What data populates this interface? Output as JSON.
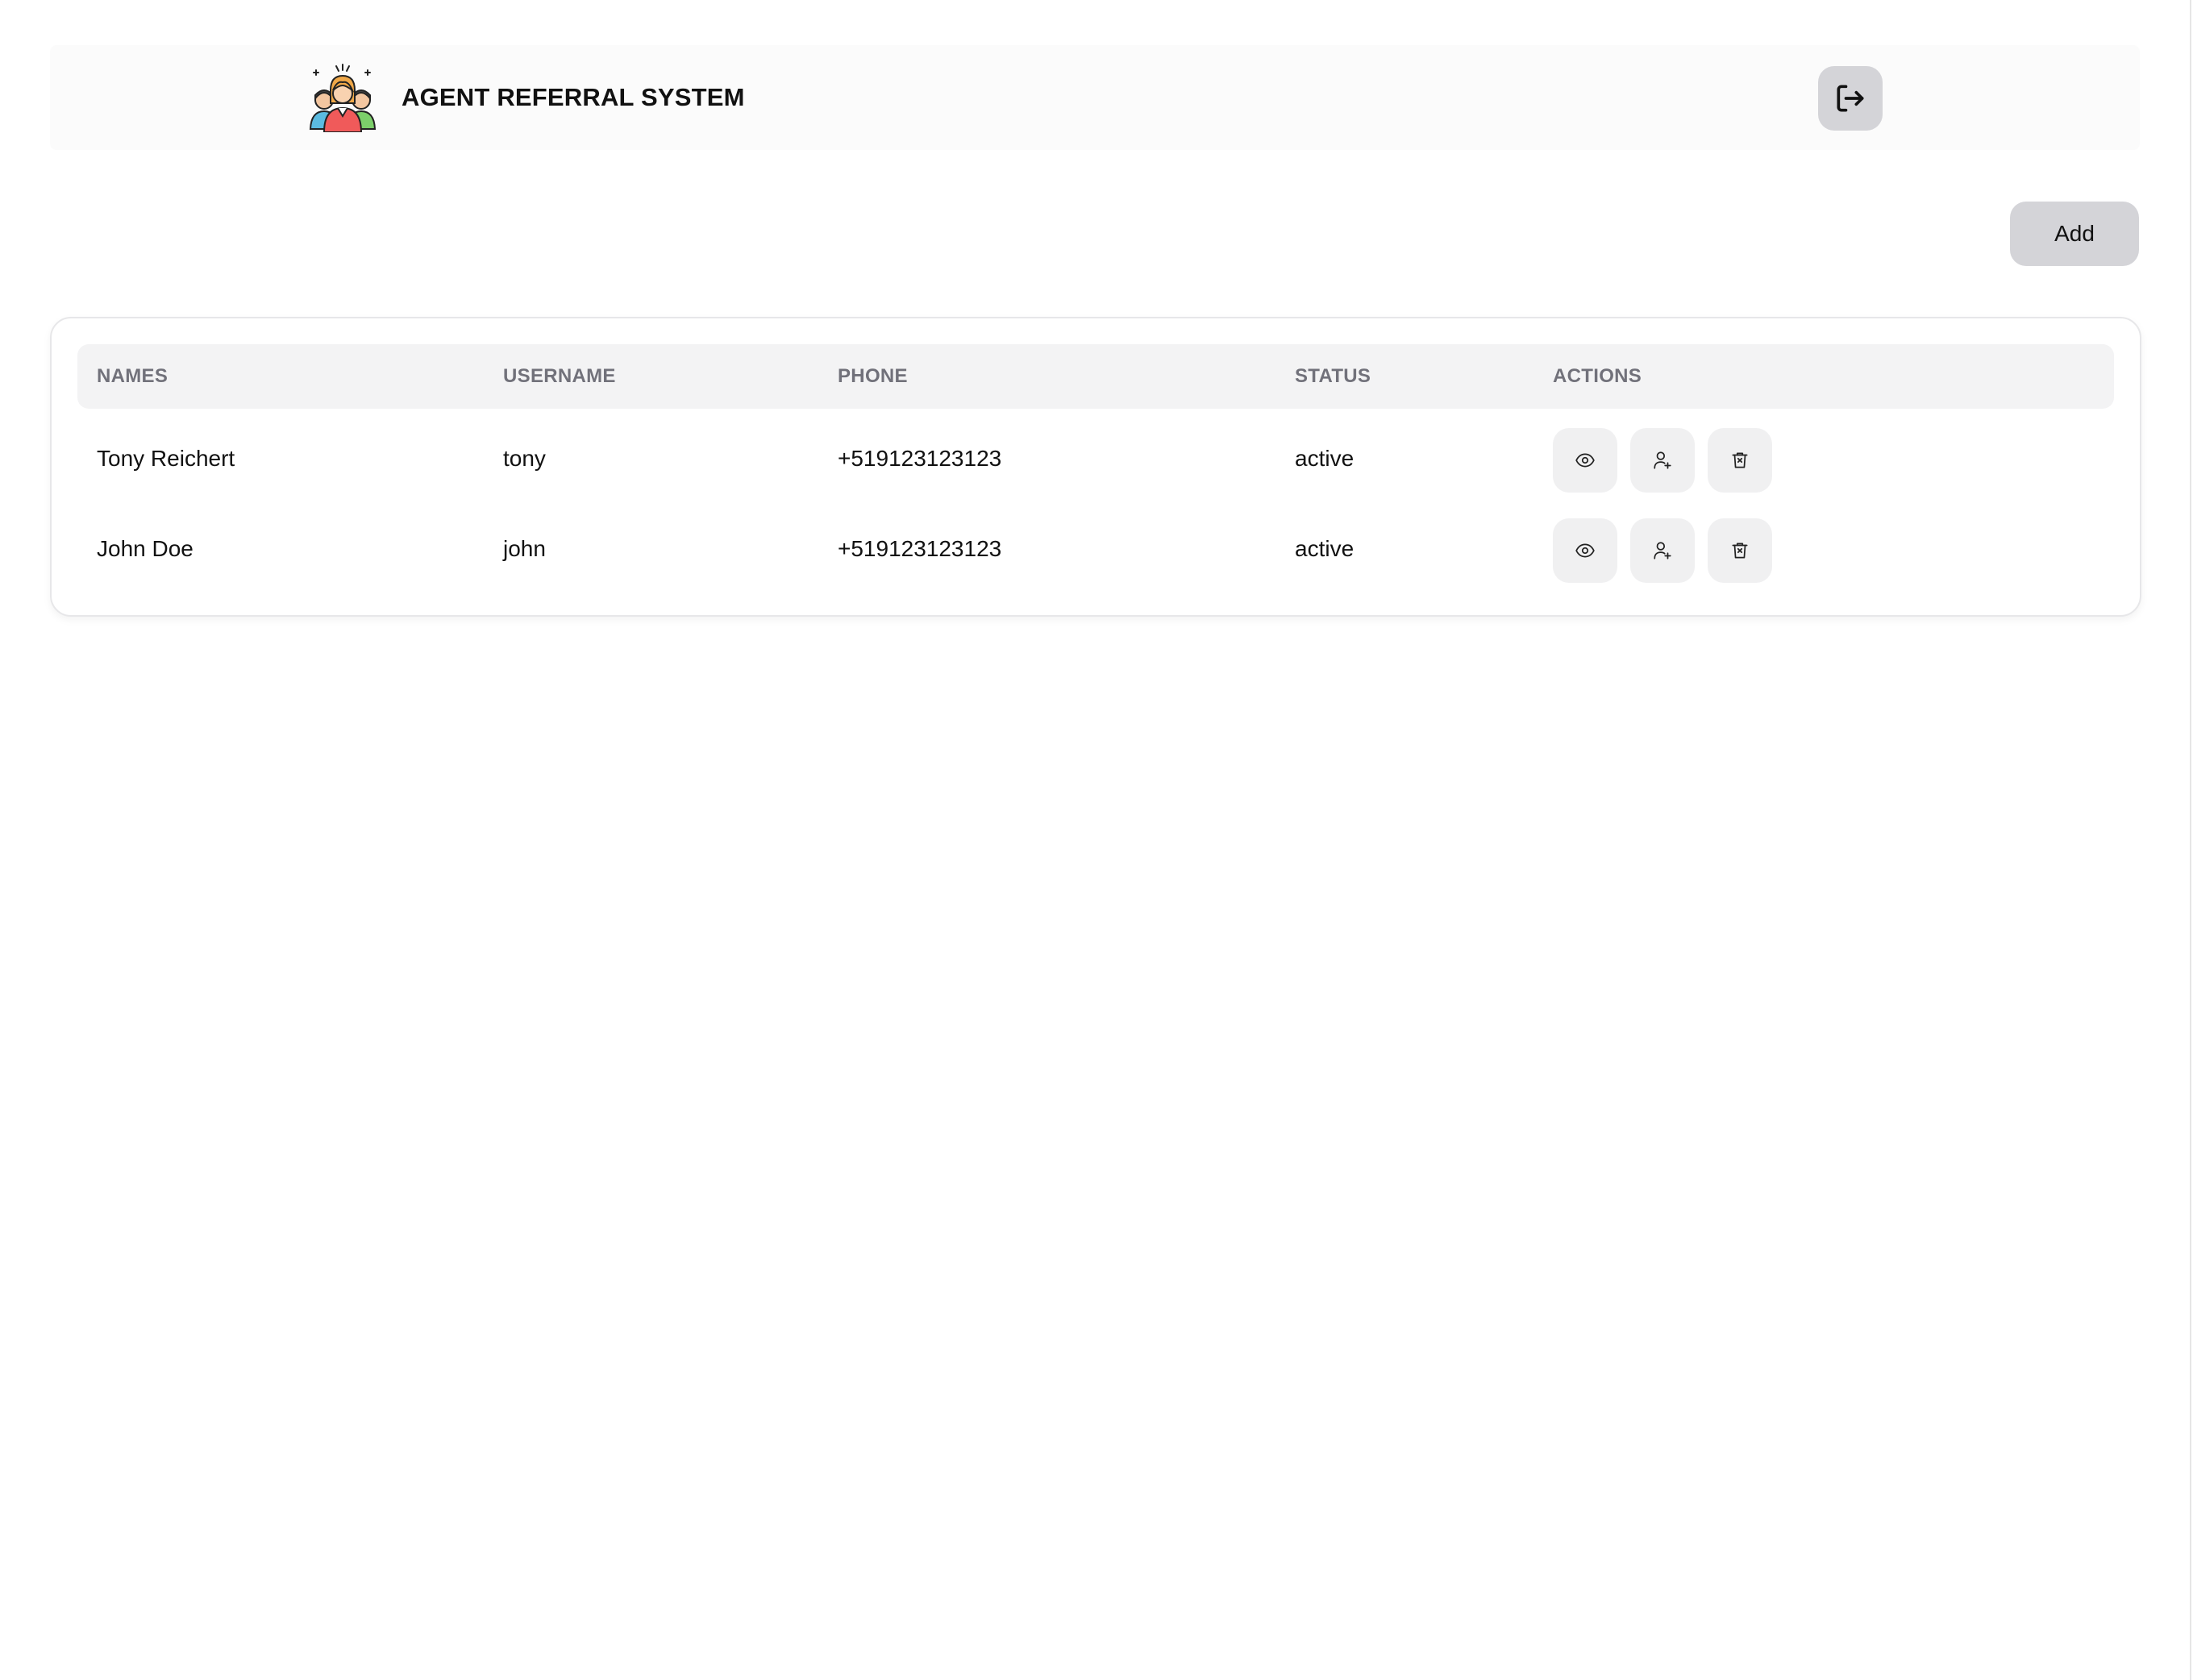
{
  "app": {
    "title": "AGENT REFERRAL SYSTEM",
    "logo_icon": "team-people-icon"
  },
  "header": {
    "logout_icon": "logout-icon"
  },
  "toolbar": {
    "add_label": "Add"
  },
  "table": {
    "columns": [
      "NAMES",
      "USERNAME",
      "PHONE",
      "STATUS",
      "ACTIONS"
    ],
    "rows": [
      {
        "names": "Tony Reichert",
        "username": "tony",
        "phone": "+519123123123",
        "status": "active"
      },
      {
        "names": "John Doe",
        "username": "john",
        "phone": "+519123123123",
        "status": "active"
      }
    ],
    "action_icons": [
      "eye-icon",
      "user-plus-icon",
      "trash-icon"
    ]
  },
  "colors": {
    "header_bg": "#fbfbfb",
    "button_bg": "#d4d4d8",
    "action_button_bg": "#f0f0f1",
    "table_header_bg": "#f3f3f4",
    "table_header_text": "#71717a"
  }
}
